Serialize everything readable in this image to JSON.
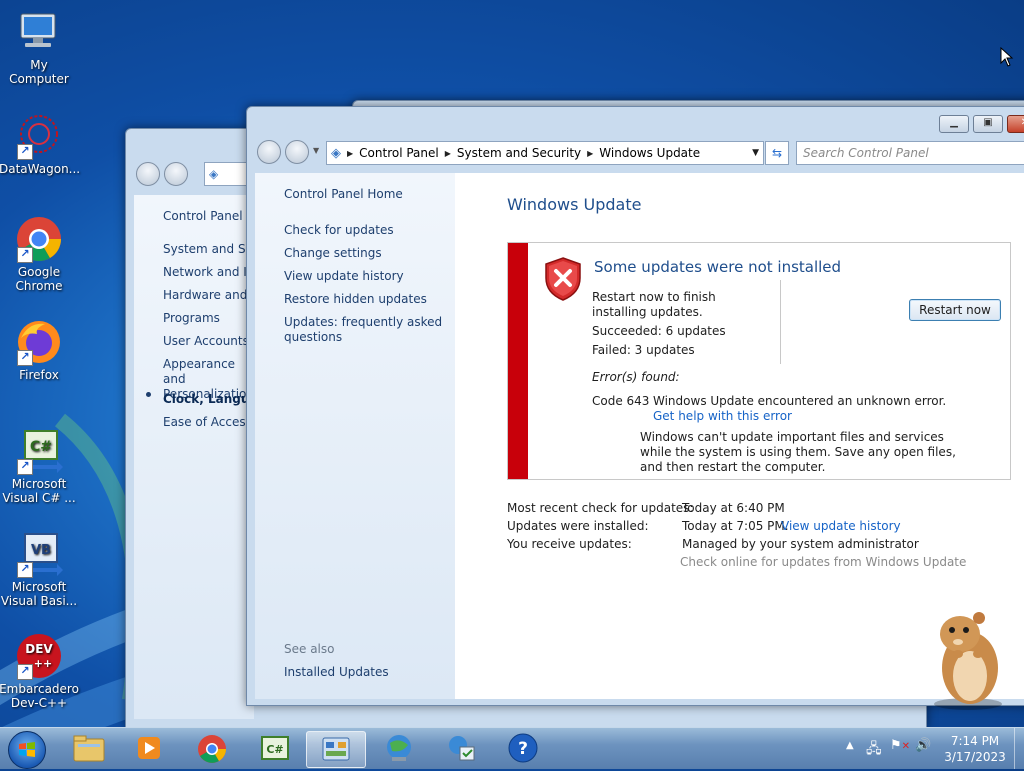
{
  "desktop": {
    "icons": [
      {
        "label": "My Computer"
      },
      {
        "label": "DataWagon..."
      },
      {
        "label": "Google Chrome"
      },
      {
        "label": "Firefox"
      },
      {
        "label": "Microsoft Visual C# ..."
      },
      {
        "label": "Microsoft Visual Basi..."
      },
      {
        "label": "Embarcadero Dev-C++"
      }
    ]
  },
  "back_window": {
    "nav_items": [
      {
        "label": "Control Panel H"
      },
      {
        "label": "System and Sec"
      },
      {
        "label": "Network and Int"
      },
      {
        "label": "Hardware and S"
      },
      {
        "label": "Programs"
      },
      {
        "label": "User Accounts"
      },
      {
        "label": "Appearance and Personalization"
      },
      {
        "label": "Clock, Language"
      },
      {
        "label": "Ease of Access"
      }
    ]
  },
  "window": {
    "breadcrumb": [
      "Control Panel",
      "System and Security",
      "Windows Update"
    ],
    "search_placeholder": "Search Control Panel",
    "left_links": {
      "home": "Control Panel Home",
      "check": "Check for updates",
      "change": "Change settings",
      "history": "View update history",
      "restore": "Restore hidden updates",
      "faq": "Updates: frequently asked questions",
      "see_also": "See also",
      "installed": "Installed Updates"
    },
    "page_title": "Windows Update",
    "status": {
      "title": "Some updates were not installed",
      "restart_msg": "Restart now to finish installing updates.",
      "succeeded": "Succeeded: 6 updates",
      "failed": "Failed: 3 updates",
      "errors_found": "Error(s) found:",
      "code": "Code 643",
      "error_msg": "Windows Update encountered an unknown error.",
      "help_link": "Get help with this error",
      "explain": "Windows can't update important files and services while the system is using them. Save any open files, and then restart the computer.",
      "restart_button": "Restart now"
    },
    "info": {
      "recent_label": "Most recent check for updates:",
      "recent_value": "Today at 6:40 PM",
      "installed_label": "Updates were installed:",
      "installed_value": "Today at 7:05 PM.",
      "history_link": "View update history",
      "receive_label": "You receive updates:",
      "receive_value": "Managed by your system administrator",
      "online_link": "Check online for updates from Windows Update"
    }
  },
  "taskbar": {
    "time": "7:14 PM",
    "date": "3/17/2023"
  },
  "colors": {
    "error_red": "#c8000a",
    "title_blue": "#1f4e8c",
    "link_blue": "#1663c7"
  }
}
